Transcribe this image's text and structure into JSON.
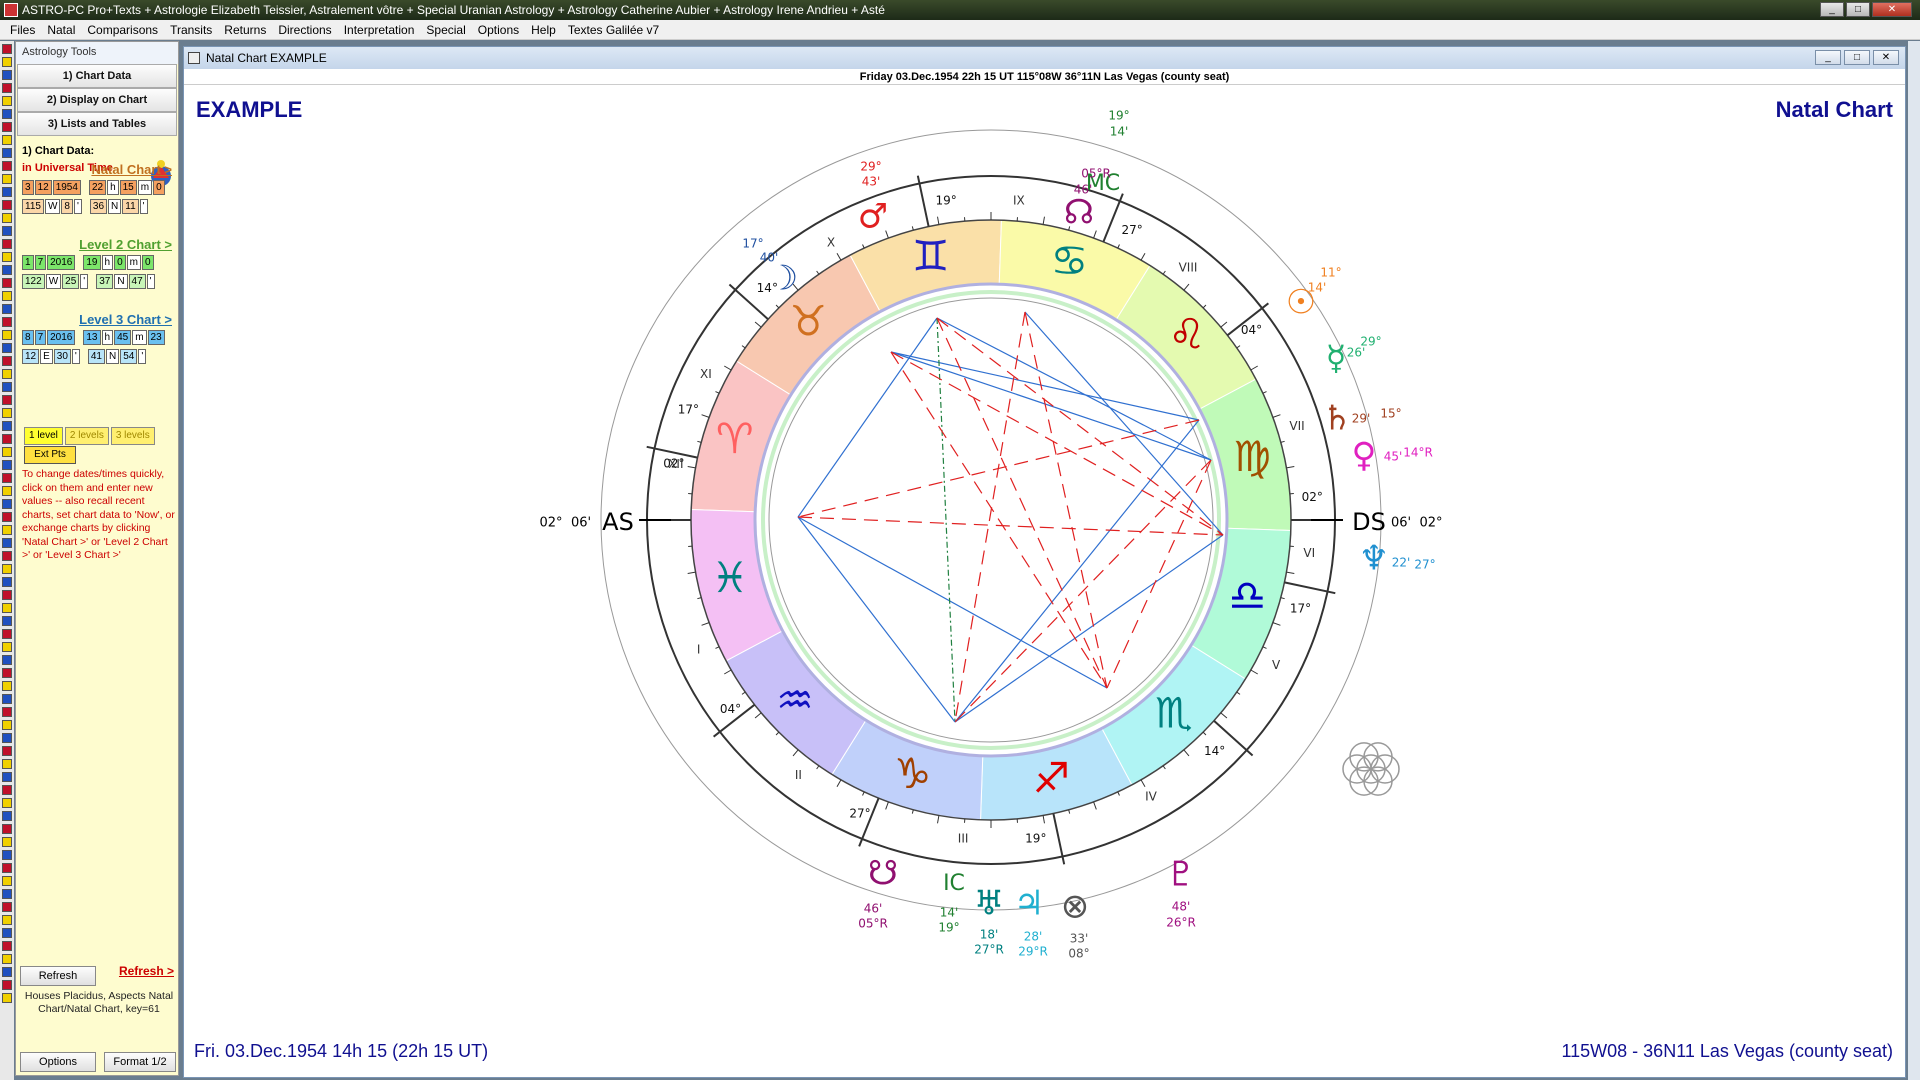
{
  "app": {
    "title": "ASTRO-PC Pro+Texts + Astrologie Elizabeth Teissier, Astralement vôtre + Special Uranian Astrology + Astrology Catherine Aubier + Astrology Irene Andrieu + Asté",
    "win_min": "_",
    "win_max": "□",
    "win_close": "✕"
  },
  "menu": [
    "Files",
    "Natal",
    "Comparisons",
    "Transits",
    "Returns",
    "Directions",
    "Interpretation",
    "Special",
    "Options",
    "Help",
    "Textes Galilée v7"
  ],
  "sidebar": {
    "header": "Astrology Tools",
    "tabs": [
      "1) Chart Data",
      "2) Display on Chart",
      "3) Lists and Tables"
    ],
    "section_title": "1) Chart Data:",
    "time_mode": "in Universal Time",
    "natal_link": "Natal Chart >",
    "level2_link": "Level 2 Chart >",
    "level3_link": "Level 3 Chart >",
    "natal": {
      "date": [
        "3",
        "12",
        "1954"
      ],
      "time": [
        "22",
        "h",
        "15",
        "m",
        "0"
      ],
      "lon": [
        "115",
        "W",
        "8",
        "'"
      ],
      "lat": [
        "36",
        "N",
        "11",
        "'"
      ]
    },
    "level2": {
      "date": [
        "1",
        "7",
        "2016"
      ],
      "time": [
        "19",
        "h",
        "0",
        "m",
        "0"
      ],
      "lon": [
        "122",
        "W",
        "25",
        "'"
      ],
      "lat": [
        "37",
        "N",
        "47",
        "'"
      ]
    },
    "level3": {
      "date": [
        "8",
        "7",
        "2016"
      ],
      "time": [
        "13",
        "h",
        "45",
        "m",
        "23"
      ],
      "lon": [
        "12",
        "E",
        "30",
        "'"
      ],
      "lat": [
        "41",
        "N",
        "54",
        "'"
      ]
    },
    "levels": [
      "1 level",
      "2 levels",
      "3 levels"
    ],
    "ext_pts": "Ext Pts",
    "help": "To change dates/times quickly, click on them and enter new values -- also recall recent charts, set chart data to 'Now', or exchange charts by clicking 'Natal Chart >' or 'Level 2 Chart >' or 'Level 3 Chart >'",
    "refresh_button": "Refresh",
    "refresh_link": "Refresh >",
    "houses_info": "Houses Placidus, Aspects Natal Chart/Natal Chart, key=61",
    "options_button": "Options",
    "format_button": "Format 1/2"
  },
  "chart_window": {
    "title": "Natal Chart  EXAMPLE",
    "date_bar": "Friday 03.Dec.1954 22h 15 UT 115°08W 36°11N  Las Vegas (county seat)",
    "name": "EXAMPLE",
    "chart_type": "Natal Chart",
    "footer_left": "Fri. 03.Dec.1954 14h 15 (22h 15 UT)",
    "footer_right": "115W08 - 36N11  Las Vegas (county seat)"
  },
  "chart": {
    "colors": {
      "aries": "#ff6060",
      "taurus": "#d07020",
      "gemini": "#2020c0",
      "cancer": "#008080",
      "leo": "#c00000",
      "virgo": "#a05000",
      "libra": "#0000c0",
      "scorpio": "#008080",
      "sagittarius": "#e00000",
      "capricorn": "#a04000",
      "aquarius": "#1010c0",
      "pisces": "#008080",
      "aspect_red": "#e02020",
      "aspect_blue": "#3070d0",
      "aspect_green": "#208040"
    },
    "houses": [
      {
        "num": "I",
        "cusp": "02°"
      },
      {
        "num": "II",
        "cusp": "04°"
      },
      {
        "num": "III",
        "cusp": "27°"
      },
      {
        "num": "IV",
        "cusp": "19°"
      },
      {
        "num": "V",
        "cusp": "14°"
      },
      {
        "num": "VI",
        "cusp": "17°"
      },
      {
        "num": "VII",
        "cusp": "02°"
      },
      {
        "num": "VIII",
        "cusp": "04°"
      },
      {
        "num": "IX",
        "cusp": "27°"
      },
      {
        "num": "X",
        "cusp": "19°"
      },
      {
        "num": "XI",
        "cusp": "14°"
      },
      {
        "num": "XII",
        "cusp": "17°"
      }
    ],
    "angles": {
      "as": {
        "label": "AS",
        "deg": "02°",
        "min": "06'"
      },
      "ds": {
        "label": "DS",
        "deg": "02°",
        "min": "06'"
      },
      "mc": {
        "label": "MC",
        "deg": "19°",
        "min": "14'"
      },
      "ic": {
        "label": "IC",
        "deg": "19°",
        "min": "14'"
      }
    },
    "planets": [
      {
        "name": "mars",
        "glyph": "♂",
        "deg": "29°",
        "min": "43'",
        "color": "#e02020"
      },
      {
        "name": "moon",
        "glyph": "☽",
        "deg": "17°",
        "min": "40'",
        "color": "#2050a0"
      },
      {
        "name": "north-node",
        "glyph": "☊",
        "deg": "05°R",
        "min": "46'",
        "color": "#901070"
      },
      {
        "name": "sun",
        "glyph": "☉",
        "deg": "11°",
        "min": "14'",
        "color": "#f08020"
      },
      {
        "name": "mercury",
        "glyph": "☿",
        "deg": "29°",
        "min": "26'",
        "color": "#20b070"
      },
      {
        "name": "saturn",
        "glyph": "♄",
        "deg": "15°",
        "min": "29'",
        "color": "#a04020"
      },
      {
        "name": "venus",
        "glyph": "♀",
        "deg": "14°R",
        "min": "45'",
        "color": "#e020c0"
      },
      {
        "name": "neptune",
        "glyph": "♆",
        "deg": "27°",
        "min": "22'",
        "color": "#2090d0"
      },
      {
        "name": "pluto",
        "glyph": "♇",
        "deg": "26°R",
        "min": "48'",
        "color": "#a01080"
      },
      {
        "name": "south-node",
        "glyph": "☋",
        "deg": "05°R",
        "min": "46'",
        "color": "#901070"
      },
      {
        "name": "uranus",
        "glyph": "♅",
        "deg": "27°R",
        "min": "18'",
        "color": "#008080"
      },
      {
        "name": "jupiter",
        "glyph": "♃",
        "deg": "29°R",
        "min": "28'",
        "color": "#20b0d0"
      },
      {
        "name": "part-of-fortune",
        "glyph": "⊗",
        "deg": "08°",
        "min": "33'",
        "color": "#555555"
      }
    ]
  }
}
